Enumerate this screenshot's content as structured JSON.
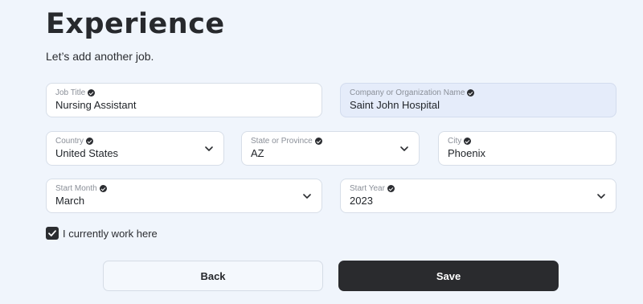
{
  "header": {
    "title": "Experience",
    "subtitle": "Let’s add another job."
  },
  "fields": {
    "job_title": {
      "label": "Job Title",
      "value": "Nursing Assistant"
    },
    "company": {
      "label": "Company or Organization Name",
      "value": "Saint John Hospital"
    },
    "country": {
      "label": "Country",
      "value": "United States"
    },
    "state": {
      "label": "State or Province",
      "value": "AZ"
    },
    "city": {
      "label": "City",
      "value": "Phoenix"
    },
    "start_month": {
      "label": "Start Month",
      "value": "March"
    },
    "start_year": {
      "label": "Start Year",
      "value": "2023"
    }
  },
  "current_job": {
    "label": "I currently work here",
    "checked": true
  },
  "actions": {
    "back_label": "Back",
    "save_label": "Save"
  },
  "colors": {
    "background": "#f0f5fc",
    "primary_button": "#2a2b2e",
    "highlight_field": "#e5ecfa"
  },
  "icons": {
    "verified": "check-circle-icon",
    "dropdown": "chevron-down-icon",
    "checkbox": "checkmark-icon"
  }
}
